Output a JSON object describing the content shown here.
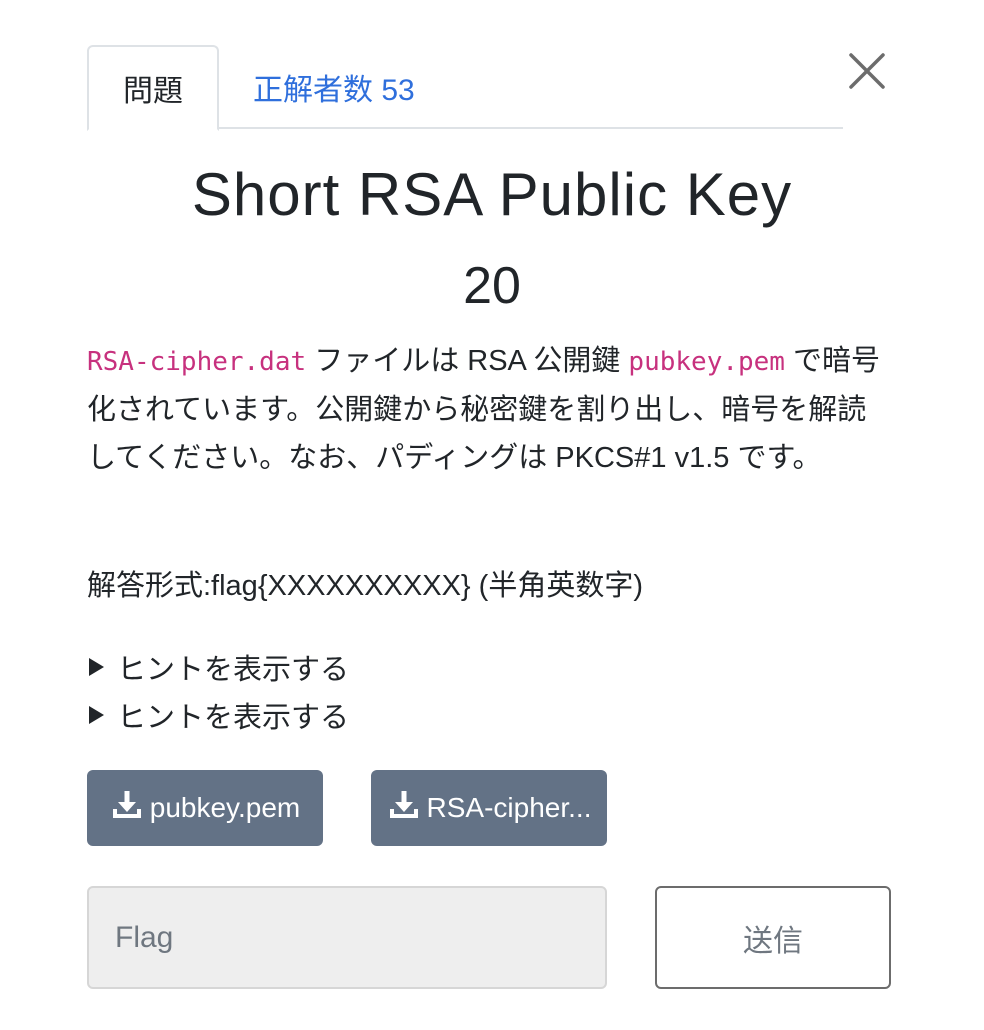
{
  "tabs": {
    "problem": "問題",
    "solvers": "正解者数 53"
  },
  "challenge": {
    "title": "Short RSA Public Key",
    "points": "20",
    "description": {
      "code1": "RSA-cipher.dat",
      "text1": " ファイルは RSA 公開鍵 ",
      "code2": "pubkey.pem",
      "text2": " で暗号化されています。公開鍵から秘密鍵を割り出し、暗号を解読してください。なお、パディングは PKCS#1 v1.5 です。"
    },
    "answer_format": "解答形式:flag{XXXXXXXXXX} (半角英数字)"
  },
  "hints": [
    {
      "label": "ヒントを表示する"
    },
    {
      "label": "ヒントを表示する"
    }
  ],
  "downloads": [
    {
      "label": "pubkey.pem",
      "icon": "download-icon"
    },
    {
      "label": "RSA-cipher...",
      "icon": "download-icon"
    }
  ],
  "form": {
    "flag_placeholder": "Flag",
    "flag_value": "",
    "submit_label": "送信"
  },
  "icons": {
    "close": "close-icon",
    "hint_toggle": "triangle-right-icon"
  },
  "colors": {
    "link": "#2f6fdc",
    "code": "#c7317e",
    "download_button": "#637286"
  }
}
